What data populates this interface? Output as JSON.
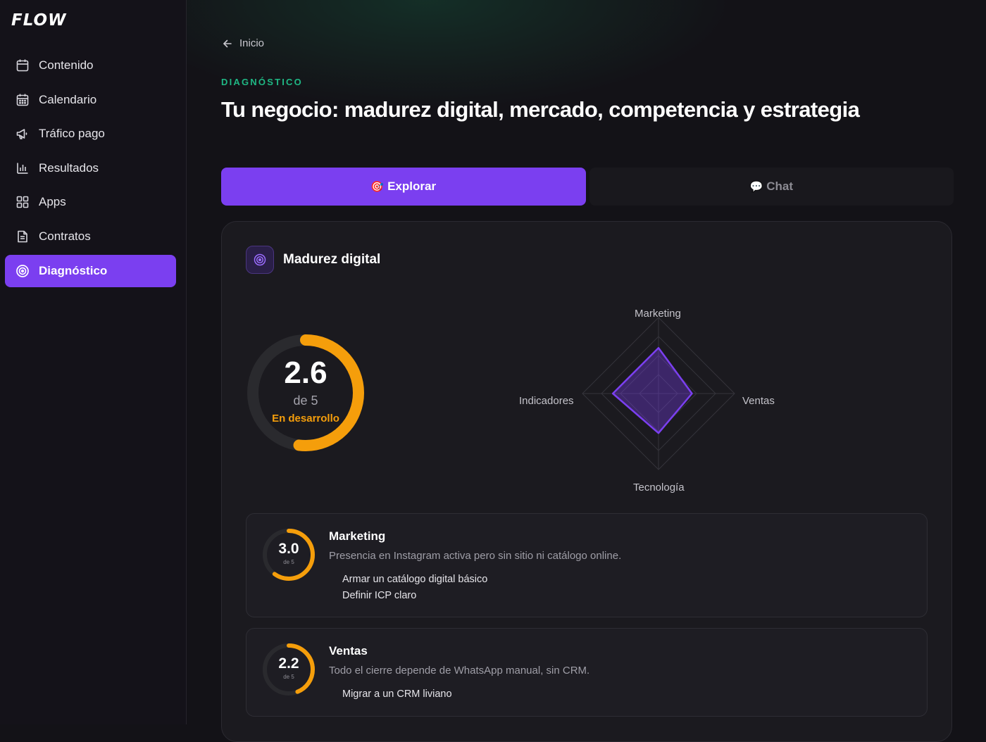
{
  "app": {
    "logo": "FLOW"
  },
  "sidebar": {
    "items": [
      {
        "label": "Contenido",
        "icon": "calendar-icon",
        "active": false
      },
      {
        "label": "Calendario",
        "icon": "calendar-grid-icon",
        "active": false
      },
      {
        "label": "Tráfico pago",
        "icon": "megaphone-icon",
        "active": false
      },
      {
        "label": "Resultados",
        "icon": "bar-chart-icon",
        "active": false
      },
      {
        "label": "Apps",
        "icon": "grid-icon",
        "active": false
      },
      {
        "label": "Contratos",
        "icon": "document-icon",
        "active": false
      },
      {
        "label": "Diagnóstico",
        "icon": "target-icon",
        "active": true
      }
    ]
  },
  "header": {
    "back_label": "Inicio",
    "eyebrow": "DIAGNÓSTICO",
    "title": "Tu negocio: madurez digital, mercado, competencia y estrategia"
  },
  "tabs": [
    {
      "emoji": "🎯",
      "label": "Explorar",
      "active": true
    },
    {
      "emoji": "💬",
      "label": "Chat",
      "active": false
    }
  ],
  "maturity": {
    "title": "Madurez digital",
    "score": "2.6",
    "scale": "de 5",
    "status": "En desarrollo",
    "score_value": 2.6,
    "score_max": 5,
    "radar": {
      "axes": [
        "Marketing",
        "Ventas",
        "Tecnología",
        "Indicadores"
      ],
      "values": [
        3.0,
        2.2,
        2.6,
        3.0
      ],
      "max": 5,
      "rings": 4
    },
    "areas": [
      {
        "title": "Marketing",
        "score": "3.0",
        "scale": "de 5",
        "score_value": 3.0,
        "description": "Presencia en Instagram activa pero sin sitio ni catálogo online.",
        "actions": [
          "Armar un catálogo digital básico",
          "Definir ICP claro"
        ]
      },
      {
        "title": "Ventas",
        "score": "2.2",
        "scale": "de 5",
        "score_value": 2.2,
        "description": "Todo el cierre depende de WhatsApp manual, sin CRM.",
        "actions": [
          "Migrar a un CRM liviano"
        ]
      }
    ]
  },
  "colors": {
    "accent": "#7b3ff0",
    "gauge": "#f59e0b",
    "eyebrow": "#1fb784",
    "track": "#2a2a2e"
  }
}
